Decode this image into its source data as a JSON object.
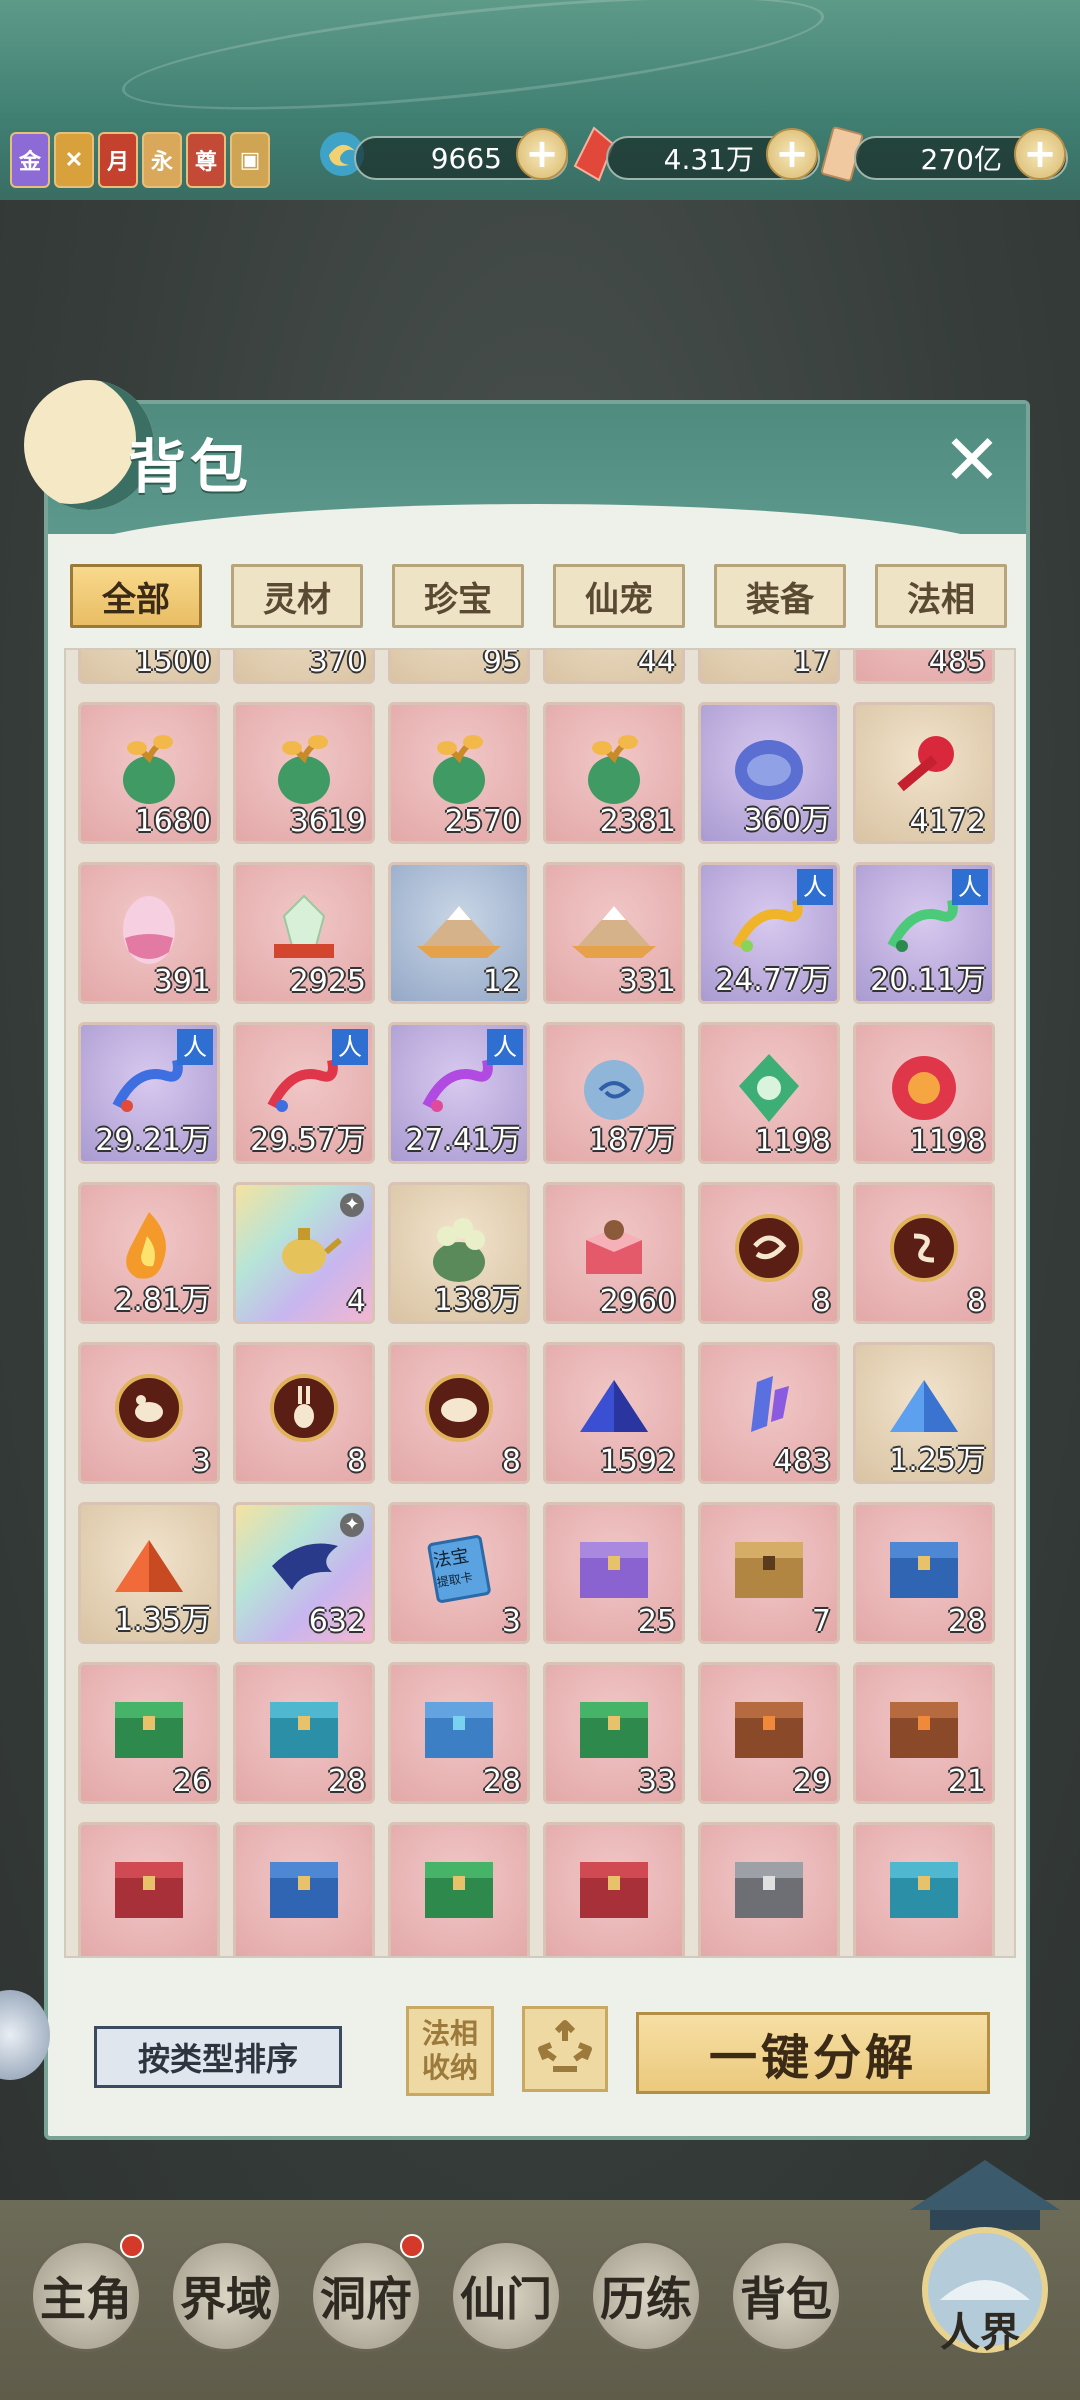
{
  "top_icons": [
    {
      "name": "gold-badge-icon",
      "glyph": "金",
      "color": "#8c6bd6"
    },
    {
      "name": "festival-badge-icon",
      "glyph": "✕",
      "color": "#d9a13b"
    },
    {
      "name": "monthly-card-icon",
      "glyph": "月",
      "color": "#c4412e"
    },
    {
      "name": "permanent-card-icon",
      "glyph": "永",
      "color": "#d9a85b"
    },
    {
      "name": "vip-card-icon",
      "glyph": "尊",
      "color": "#c44a38"
    },
    {
      "name": "pass-card-icon",
      "glyph": "▣",
      "color": "#cfa452"
    }
  ],
  "resources": [
    {
      "name": "spirit-jade",
      "value": "9665"
    },
    {
      "name": "crystal",
      "value": "4.31万"
    },
    {
      "name": "talisman",
      "value": "270亿"
    }
  ],
  "panel": {
    "title": "背包"
  },
  "tabs": [
    "全部",
    "灵材",
    "珍宝",
    "仙宠",
    "装备",
    "法相"
  ],
  "items": [
    {
      "bg": "tan",
      "icon": "gourd",
      "count": "1500"
    },
    {
      "bg": "tan",
      "icon": "gourd",
      "count": "370"
    },
    {
      "bg": "tan",
      "icon": "gourd",
      "count": "95"
    },
    {
      "bg": "tan",
      "icon": "gourd",
      "count": "44"
    },
    {
      "bg": "tan",
      "icon": "gourd",
      "count": "17"
    },
    {
      "bg": "pink",
      "icon": "gourd",
      "count": "485"
    },
    {
      "bg": "pink",
      "icon": "gourd",
      "count": "1680"
    },
    {
      "bg": "pink",
      "icon": "gourd",
      "count": "3619"
    },
    {
      "bg": "pink",
      "icon": "gourd",
      "count": "2570"
    },
    {
      "bg": "pink",
      "icon": "gourd",
      "count": "2381"
    },
    {
      "bg": "purple",
      "icon": "orb",
      "count": "360万"
    },
    {
      "bg": "tan",
      "icon": "key",
      "count": "4172"
    },
    {
      "bg": "pink",
      "icon": "egg",
      "count": "391"
    },
    {
      "bg": "pink",
      "icon": "gem",
      "count": "2925"
    },
    {
      "bg": "blue",
      "icon": "mountain",
      "count": "12"
    },
    {
      "bg": "pink",
      "icon": "mountain",
      "count": "331"
    },
    {
      "bg": "purple",
      "icon": "dragon-gold",
      "count": "24.77万",
      "ren": true
    },
    {
      "bg": "purple",
      "icon": "dragon-green",
      "count": "20.11万",
      "ren": true
    },
    {
      "bg": "purple",
      "icon": "dragon-blue",
      "count": "29.21万",
      "ren": true
    },
    {
      "bg": "pink",
      "icon": "dragon-red",
      "count": "29.57万",
      "ren": true
    },
    {
      "bg": "purple",
      "icon": "dragon-purple",
      "count": "27.41万",
      "ren": true
    },
    {
      "bg": "pink",
      "icon": "swirl-orb",
      "count": "187万"
    },
    {
      "bg": "pink",
      "icon": "green-crest",
      "count": "1198"
    },
    {
      "bg": "pink",
      "icon": "red-crest",
      "count": "1198"
    },
    {
      "bg": "pink",
      "icon": "fire",
      "count": "2.81万"
    },
    {
      "bg": "rainbow",
      "icon": "teapot",
      "count": "4",
      "special": true
    },
    {
      "bg": "tan",
      "icon": "pot",
      "count": "138万"
    },
    {
      "bg": "pink",
      "icon": "box",
      "count": "2960"
    },
    {
      "bg": "pink",
      "icon": "token-dragon",
      "count": "8"
    },
    {
      "bg": "pink",
      "icon": "token-snake",
      "count": "8"
    },
    {
      "bg": "pink",
      "icon": "token-rat",
      "count": "3"
    },
    {
      "bg": "pink",
      "icon": "token-rabbit",
      "count": "8"
    },
    {
      "bg": "pink",
      "icon": "token-pig",
      "count": "8"
    },
    {
      "bg": "pink",
      "icon": "pyramid-blue",
      "count": "1592"
    },
    {
      "bg": "pink",
      "icon": "crystal",
      "count": "483"
    },
    {
      "bg": "tan",
      "icon": "pyramid-light",
      "count": "1.25万"
    },
    {
      "bg": "tan",
      "icon": "pyramid-red",
      "count": "1.35万"
    },
    {
      "bg": "rainbow",
      "icon": "wing",
      "count": "632",
      "special": true
    },
    {
      "bg": "pink",
      "icon": "card",
      "count": "3"
    },
    {
      "bg": "pink",
      "icon": "chest-purple",
      "count": "25"
    },
    {
      "bg": "pink",
      "icon": "chest-gold",
      "count": "7"
    },
    {
      "bg": "pink",
      "icon": "chest-blue",
      "count": "28"
    },
    {
      "bg": "pink",
      "icon": "chest-green",
      "count": "26"
    },
    {
      "bg": "pink",
      "icon": "chest-cyan",
      "count": "28"
    },
    {
      "bg": "pink",
      "icon": "chest-sky",
      "count": "28"
    },
    {
      "bg": "pink",
      "icon": "chest-green",
      "count": "33"
    },
    {
      "bg": "pink",
      "icon": "chest-bronze",
      "count": "29"
    },
    {
      "bg": "pink",
      "icon": "chest-bronze",
      "count": "21"
    },
    {
      "bg": "pink",
      "icon": "chest-red",
      "count": ""
    },
    {
      "bg": "pink",
      "icon": "chest-blue",
      "count": ""
    },
    {
      "bg": "pink",
      "icon": "chest-green",
      "count": ""
    },
    {
      "bg": "pink",
      "icon": "chest-red",
      "count": ""
    },
    {
      "bg": "pink",
      "icon": "chest-silver",
      "count": ""
    },
    {
      "bg": "pink",
      "icon": "chest-cyan",
      "count": ""
    }
  ],
  "card_label": "法宝",
  "card_sub": "提取卡",
  "item_badge": "人",
  "buttons": {
    "sort": "按类型排序",
    "faxiang_line1": "法相",
    "faxiang_line2": "收纳",
    "decompose": "一键分解"
  },
  "nav": [
    {
      "label": "主角",
      "dot": true
    },
    {
      "label": "界域",
      "dot": false
    },
    {
      "label": "洞府",
      "dot": true
    },
    {
      "label": "仙门",
      "dot": false
    },
    {
      "label": "历练",
      "dot": false
    },
    {
      "label": "背包",
      "dot": false
    }
  ],
  "realm_button": "人界"
}
